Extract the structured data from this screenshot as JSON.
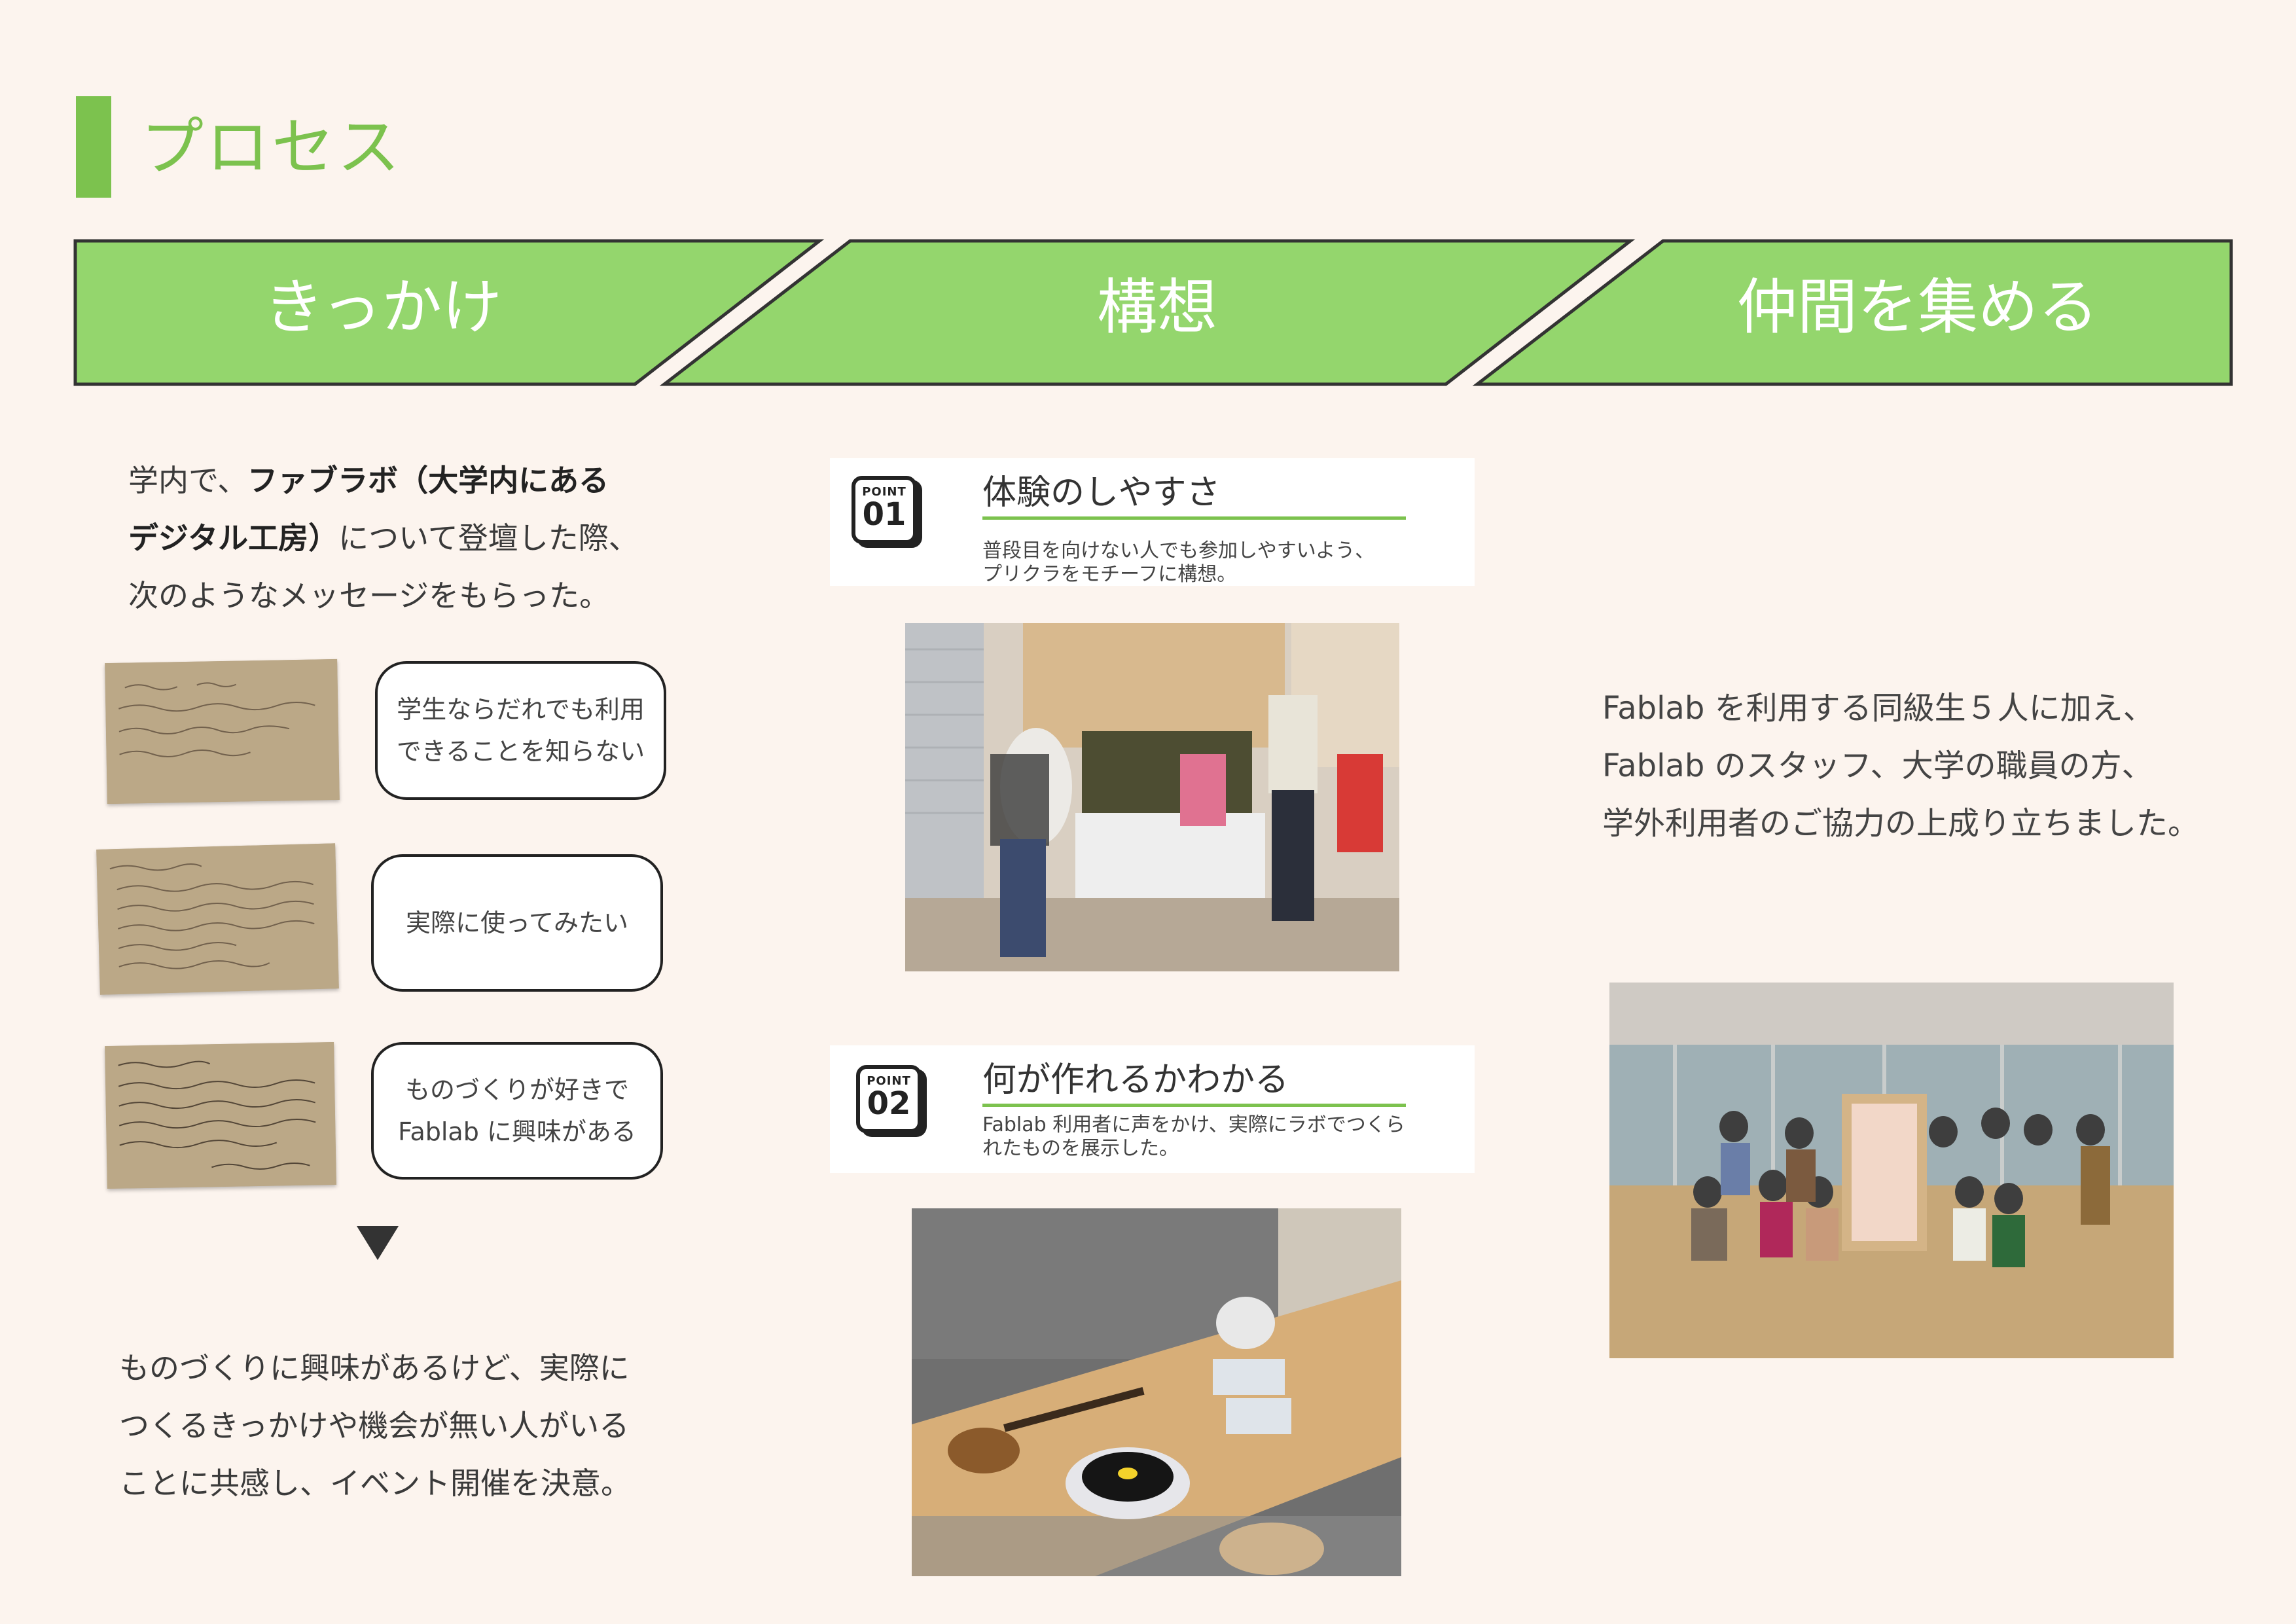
{
  "page": {
    "title": "プロセス"
  },
  "banner": {
    "steps": [
      "きっかけ",
      "構想",
      "仲間を集める"
    ],
    "color": "#94d66d",
    "border": "#333333"
  },
  "kikkake": {
    "intro_1a": "学内で、",
    "intro_1b": "ファブラボ（大学内にある",
    "intro_2a": "デジタル工房）",
    "intro_2b": "について登壇した際、",
    "intro_3": "次のようなメッセージをもらった。",
    "messages": [
      {
        "line1": "学生ならだれでも利用",
        "line2": "できることを知らない"
      },
      {
        "line1": "実際に使ってみたい",
        "line2": ""
      },
      {
        "line1": "ものづくりが好きで",
        "line2": "Fablab に興味がある"
      }
    ],
    "conclusion_1": "ものづくりに興味があるけど、実際に",
    "conclusion_2": "つくるきっかけや機会が無い人がいる",
    "conclusion_3": "ことに共感し、イベント開催を決意。"
  },
  "kousou": {
    "points": [
      {
        "badge_label": "POINT",
        "badge_num": "01",
        "title": "体験のしやすさ",
        "desc_1": "普段目を向けない人でも参加しやすいよう、",
        "desc_2": "プリクラをモチーフに構想。"
      },
      {
        "badge_label": "POINT",
        "badge_num": "02",
        "title": "何が作れるかわかる",
        "desc_1": "Fablab 利用者に声をかけ、実際にラボでつくら",
        "desc_2": "れたものを展示した。"
      }
    ]
  },
  "nakama": {
    "text_1": "Fablab を利用する同級生５人に加え、",
    "text_2": "Fablab のスタッフ、大学の職員の方、",
    "text_3": "学外利用者のご協力の上成り立ちました。"
  },
  "colors": {
    "accent": "#7cc24e",
    "background": "#fcf4ee"
  }
}
